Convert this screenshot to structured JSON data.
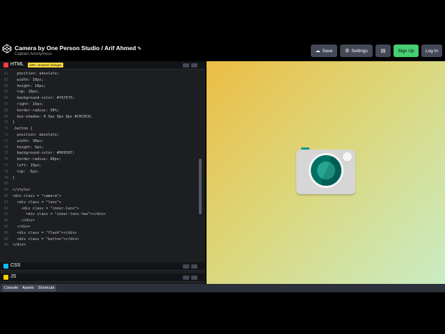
{
  "header": {
    "title": "Camera by One Person Studio / Arif Ahmed",
    "author": "Captain Anonymous",
    "buttons": {
      "save": "Save",
      "settings": "Settings",
      "signup": "Sign Up",
      "login": "Log In"
    }
  },
  "editor": {
    "html_label": "HTML",
    "unsaved_badge": "100+ unsaved changes",
    "css_label": "CSS",
    "js_label": "JS",
    "lines": [
      {
        "n": "62",
        "t": "  position: absolute;"
      },
      {
        "n": "63",
        "t": "  width: 10px;"
      },
      {
        "n": "64",
        "t": "  height: 10px;"
      },
      {
        "n": "65",
        "t": "  top: 10px;"
      },
      {
        "n": "66",
        "t": "  background-color: #f5f5f5;"
      },
      {
        "n": "67",
        "t": "  right: 15px;"
      },
      {
        "n": "68",
        "t": "  border-radius: 50%;"
      },
      {
        "n": "69",
        "t": "  box-shadow: 0 5px 0px 0px #C0C0C0;"
      },
      {
        "n": "70",
        "t": "}"
      },
      {
        "n": "71",
        "t": ".button {"
      },
      {
        "n": "72",
        "t": "  position: absolute;"
      },
      {
        "n": "73",
        "t": "  width: 30px;"
      },
      {
        "n": "74",
        "t": "  height: 5px;"
      },
      {
        "n": "75",
        "t": "  background-color: #009587;"
      },
      {
        "n": "76",
        "t": "  border-radius: 60px;"
      },
      {
        "n": "77",
        "t": "  left: 15px;"
      },
      {
        "n": "78",
        "t": "  top: -5px;"
      },
      {
        "n": "79",
        "t": "}"
      },
      {
        "n": "80",
        "t": ""
      },
      {
        "n": "81",
        "t": "</style>"
      },
      {
        "n": "82",
        "t": "<div class = \"camera\">"
      },
      {
        "n": "83",
        "t": "  <div class = \"lens\">"
      },
      {
        "n": "84",
        "t": "    <div class = \"inner-lens\">"
      },
      {
        "n": "85",
        "t": "      <div class = \"inner-lens-two\"></div>"
      },
      {
        "n": "86",
        "t": "    </div>"
      },
      {
        "n": "87",
        "t": "  </div>"
      },
      {
        "n": "88",
        "t": "  <div class = \"flash\"></div>"
      },
      {
        "n": "89",
        "t": "  <div class = \"button\"></div>"
      },
      {
        "n": "90",
        "t": "</div>"
      }
    ]
  },
  "footer": {
    "console": "Console",
    "assets": "Assets",
    "shortcuts": "Shortcuts"
  },
  "icons": [
    "codepen-logo-icon",
    "pencil-icon",
    "cloud-icon",
    "gear-icon",
    "layout-icon",
    "chevron-down-icon"
  ],
  "colors": {
    "accent_green": "#47cf73",
    "camera_teal_dark": "#007064",
    "camera_teal": "#26a592",
    "camera_button": "#009587",
    "html_badge": "#ff3c41",
    "css_badge": "#0ebeff",
    "js_badge": "#fcd000"
  }
}
